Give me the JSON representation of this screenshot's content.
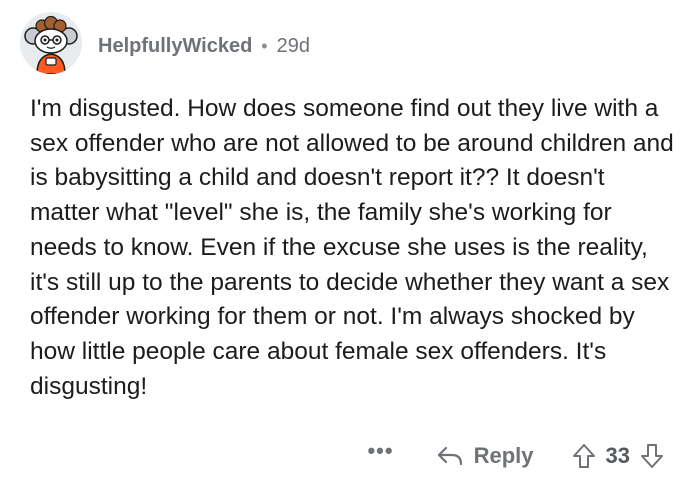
{
  "comment": {
    "author": "HelpfullyWicked",
    "separator": "•",
    "age": "29d",
    "body": "I'm disgusted. How does someone find out they live with a sex offender who are not allowed to be around children and is babysitting a child and doesn't report it?? It doesn't matter what \"level\" she is, the family she's working for needs to know. Even if the excuse she uses is the reality, it's still up to the parents to decide whether they want a sex offender working for them or not. I'm always shocked by how little people care about female sex offenders. It's disgusting!",
    "more_label": "•••",
    "reply_label": "Reply",
    "score": "33"
  },
  "icons": {
    "avatar": "snoo-avatar-icon",
    "reply": "reply-arrow-icon",
    "upvote": "upvote-arrow-icon",
    "downvote": "downvote-arrow-icon"
  },
  "colors": {
    "text": "#1c1c1c",
    "meta": "#6f7277",
    "avatar_bg": "#e9ecee",
    "avatar_accent": "#ff5a1f"
  }
}
